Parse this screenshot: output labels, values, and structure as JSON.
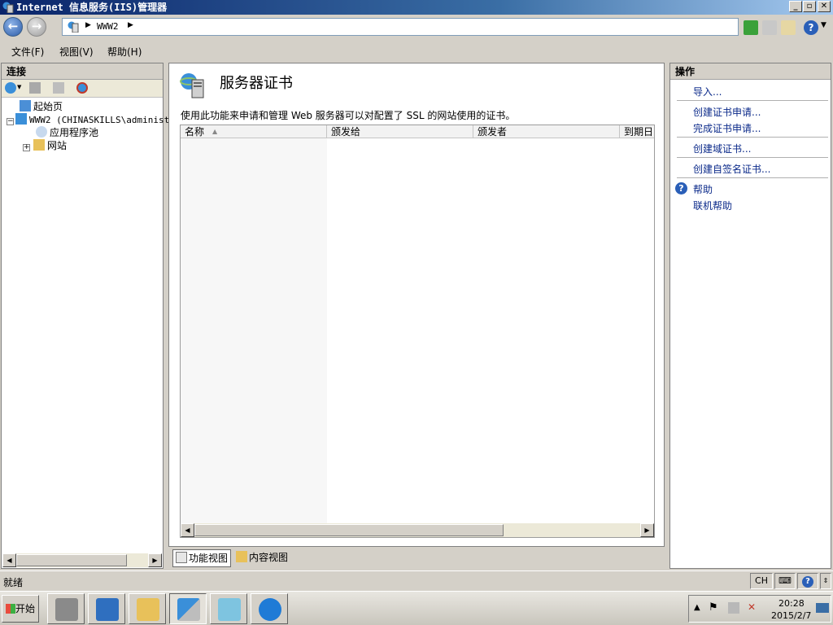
{
  "window": {
    "title": "Internet 信息服务(IIS)管理器"
  },
  "address": {
    "crumbs": [
      "WWW2"
    ]
  },
  "menu": {
    "file": "文件(F)",
    "view": "视图(V)",
    "help": "帮助(H)"
  },
  "connections": {
    "title": "连接",
    "tree": {
      "start_page": "起始页",
      "server": "WWW2 (CHINASKILLS\\administ",
      "app_pools": "应用程序池",
      "sites": "网站"
    }
  },
  "center": {
    "title": "服务器证书",
    "description": "使用此功能来申请和管理 Web 服务器可以对配置了 SSL 的网站使用的证书。",
    "columns": [
      "名称",
      "颁发给",
      "颁发者",
      "到期日"
    ],
    "sort_indicator": "▲"
  },
  "view_switch": {
    "features": "功能视图",
    "content": "内容视图"
  },
  "actions": {
    "title": "操作",
    "items": {
      "import": "导入...",
      "create_request": "创建证书申请...",
      "complete_request": "完成证书申请...",
      "create_domain": "创建域证书...",
      "create_self_signed": "创建自签名证书...",
      "help": "帮助",
      "online_help": "联机帮助"
    }
  },
  "status": {
    "text": "就绪"
  },
  "taskbar": {
    "start": "开始",
    "lang": "CH",
    "time": "20:28",
    "date": "2015/2/7"
  },
  "colors": {
    "title_gradient_start": "#0a246a",
    "link": "#0b2a8a"
  },
  "icons": {
    "app": "iis-manager-icon",
    "back": "back-arrow-icon",
    "forward": "forward-arrow-icon",
    "help": "help-icon",
    "server": "server-icon",
    "certificate": "certificate-icon"
  }
}
